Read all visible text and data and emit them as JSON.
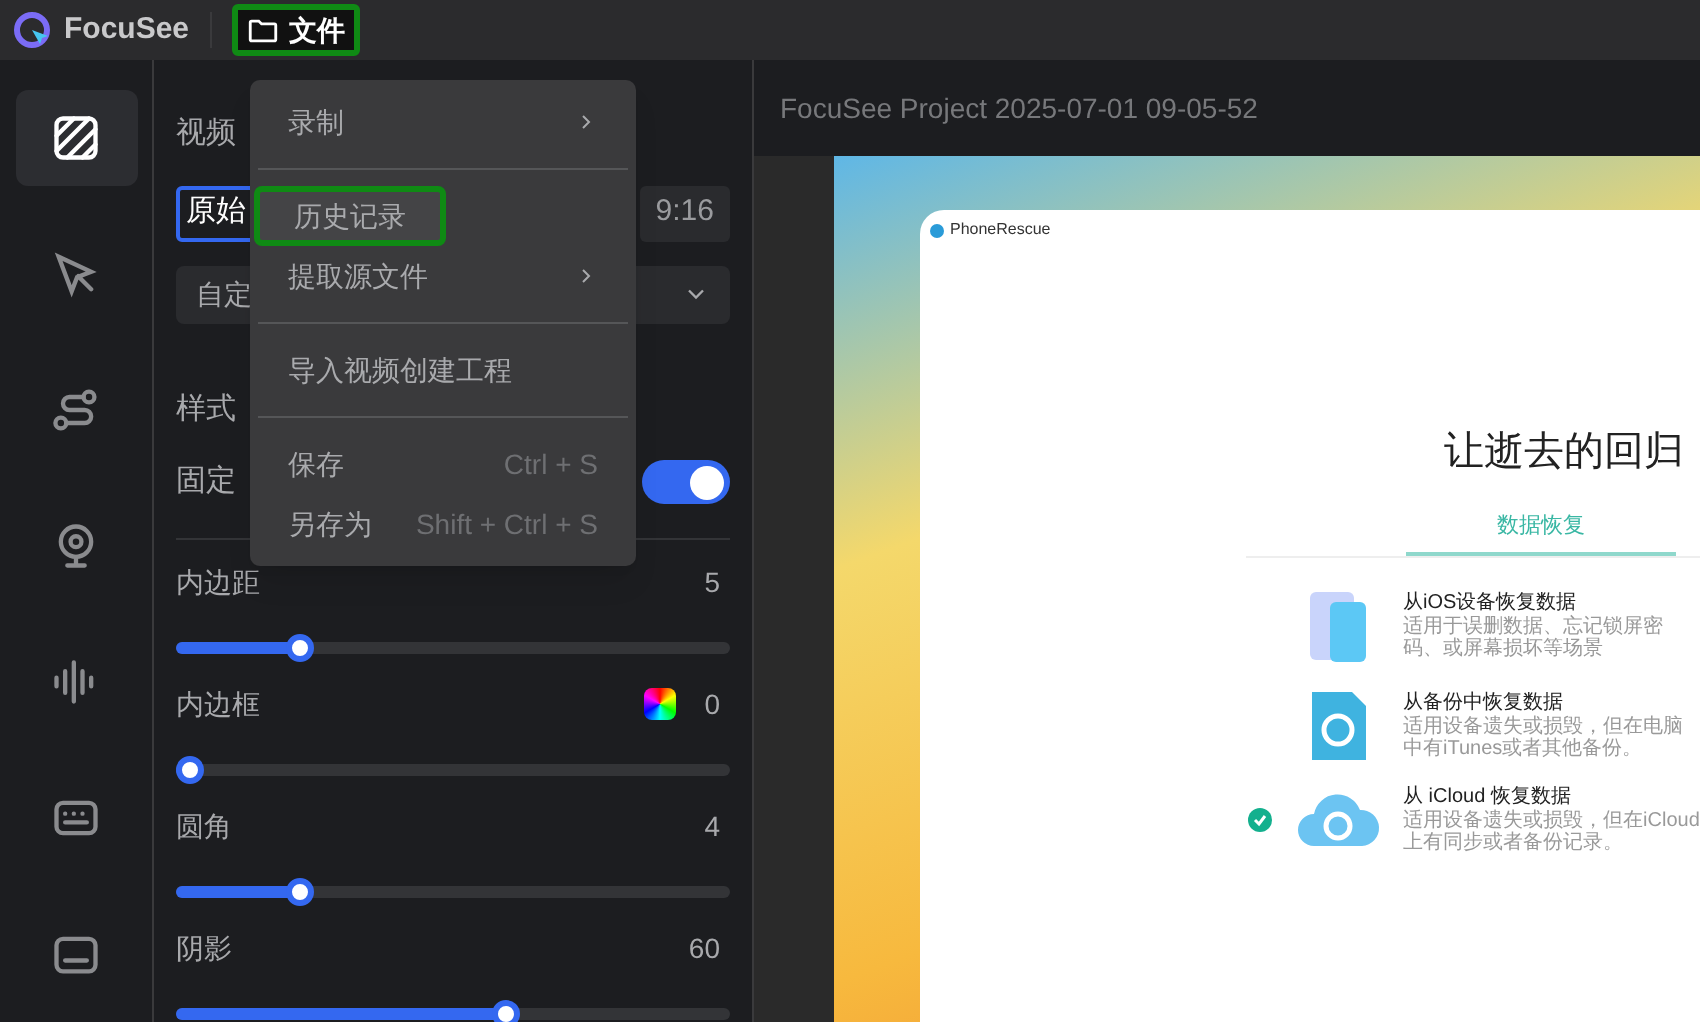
{
  "app": {
    "name": "FocuSee"
  },
  "top_menu": {
    "label": "文件",
    "highlighted": true
  },
  "file_menu": [
    {
      "kind": "submenu",
      "label": "录制",
      "highlighted": false
    },
    {
      "kind": "divider"
    },
    {
      "kind": "item",
      "label": "历史记录",
      "highlighted": true
    },
    {
      "kind": "submenu",
      "label": "提取源文件",
      "highlighted": false
    },
    {
      "kind": "divider"
    },
    {
      "kind": "item",
      "label": "导入视频创建工程",
      "highlighted": false
    },
    {
      "kind": "divider"
    },
    {
      "kind": "shortcut",
      "label": "保存",
      "shortcut": "Ctrl + S",
      "highlighted": false
    },
    {
      "kind": "shortcut",
      "label": "另存为",
      "shortcut": "Shift + Ctrl + S",
      "highlighted": false
    }
  ],
  "tool_rail": [
    {
      "kind": "background",
      "selected": true
    },
    {
      "kind": "cursor",
      "selected": false
    },
    {
      "kind": "path",
      "selected": false
    },
    {
      "kind": "camera",
      "selected": false
    },
    {
      "kind": "audio",
      "selected": false
    },
    {
      "kind": "keyboard",
      "selected": false
    },
    {
      "kind": "caption",
      "selected": false
    }
  ],
  "panel": {
    "size_label": "视频",
    "aspect_options": [
      {
        "label": "原始",
        "selected": true
      },
      {
        "label": "9:16",
        "selected": false
      }
    ],
    "preset_dropdown": "自定",
    "style_label": "样式",
    "fixed_label": "固定",
    "fixed_on": true,
    "sliders": [
      {
        "label": "内边距",
        "value": "5",
        "level": 0.21,
        "color_picker": false
      },
      {
        "label": "内边框",
        "value": "0",
        "level": 0,
        "color_picker": true
      },
      {
        "label": "圆角",
        "value": "4",
        "level": 0.21,
        "color_picker": false
      },
      {
        "label": "阴影",
        "value": "60",
        "level": 0.6,
        "color_picker": false
      }
    ]
  },
  "preview": {
    "title": "FocuSee Project 2025-07-01 09-05-52",
    "window_title": "PhoneRescue",
    "heading": "让逝去的回归",
    "tab": "数据恢复",
    "options": [
      {
        "kind": "phone",
        "title": "从iOS设备恢复数据",
        "description": "适用于误删数据、忘记锁屏密码、或屏幕损坏等场景",
        "selected": false
      },
      {
        "kind": "backup",
        "title": "从备份中恢复数据",
        "description": "适用设备遗失或损毁，但在电脑中有iTunes或者其他备份。",
        "selected": false
      },
      {
        "kind": "cloud",
        "title": "从 iCloud 恢复数据",
        "description": "适用设备遗失或损毁，但在iCloud上有同步或者备份记录。",
        "selected": true
      }
    ]
  }
}
